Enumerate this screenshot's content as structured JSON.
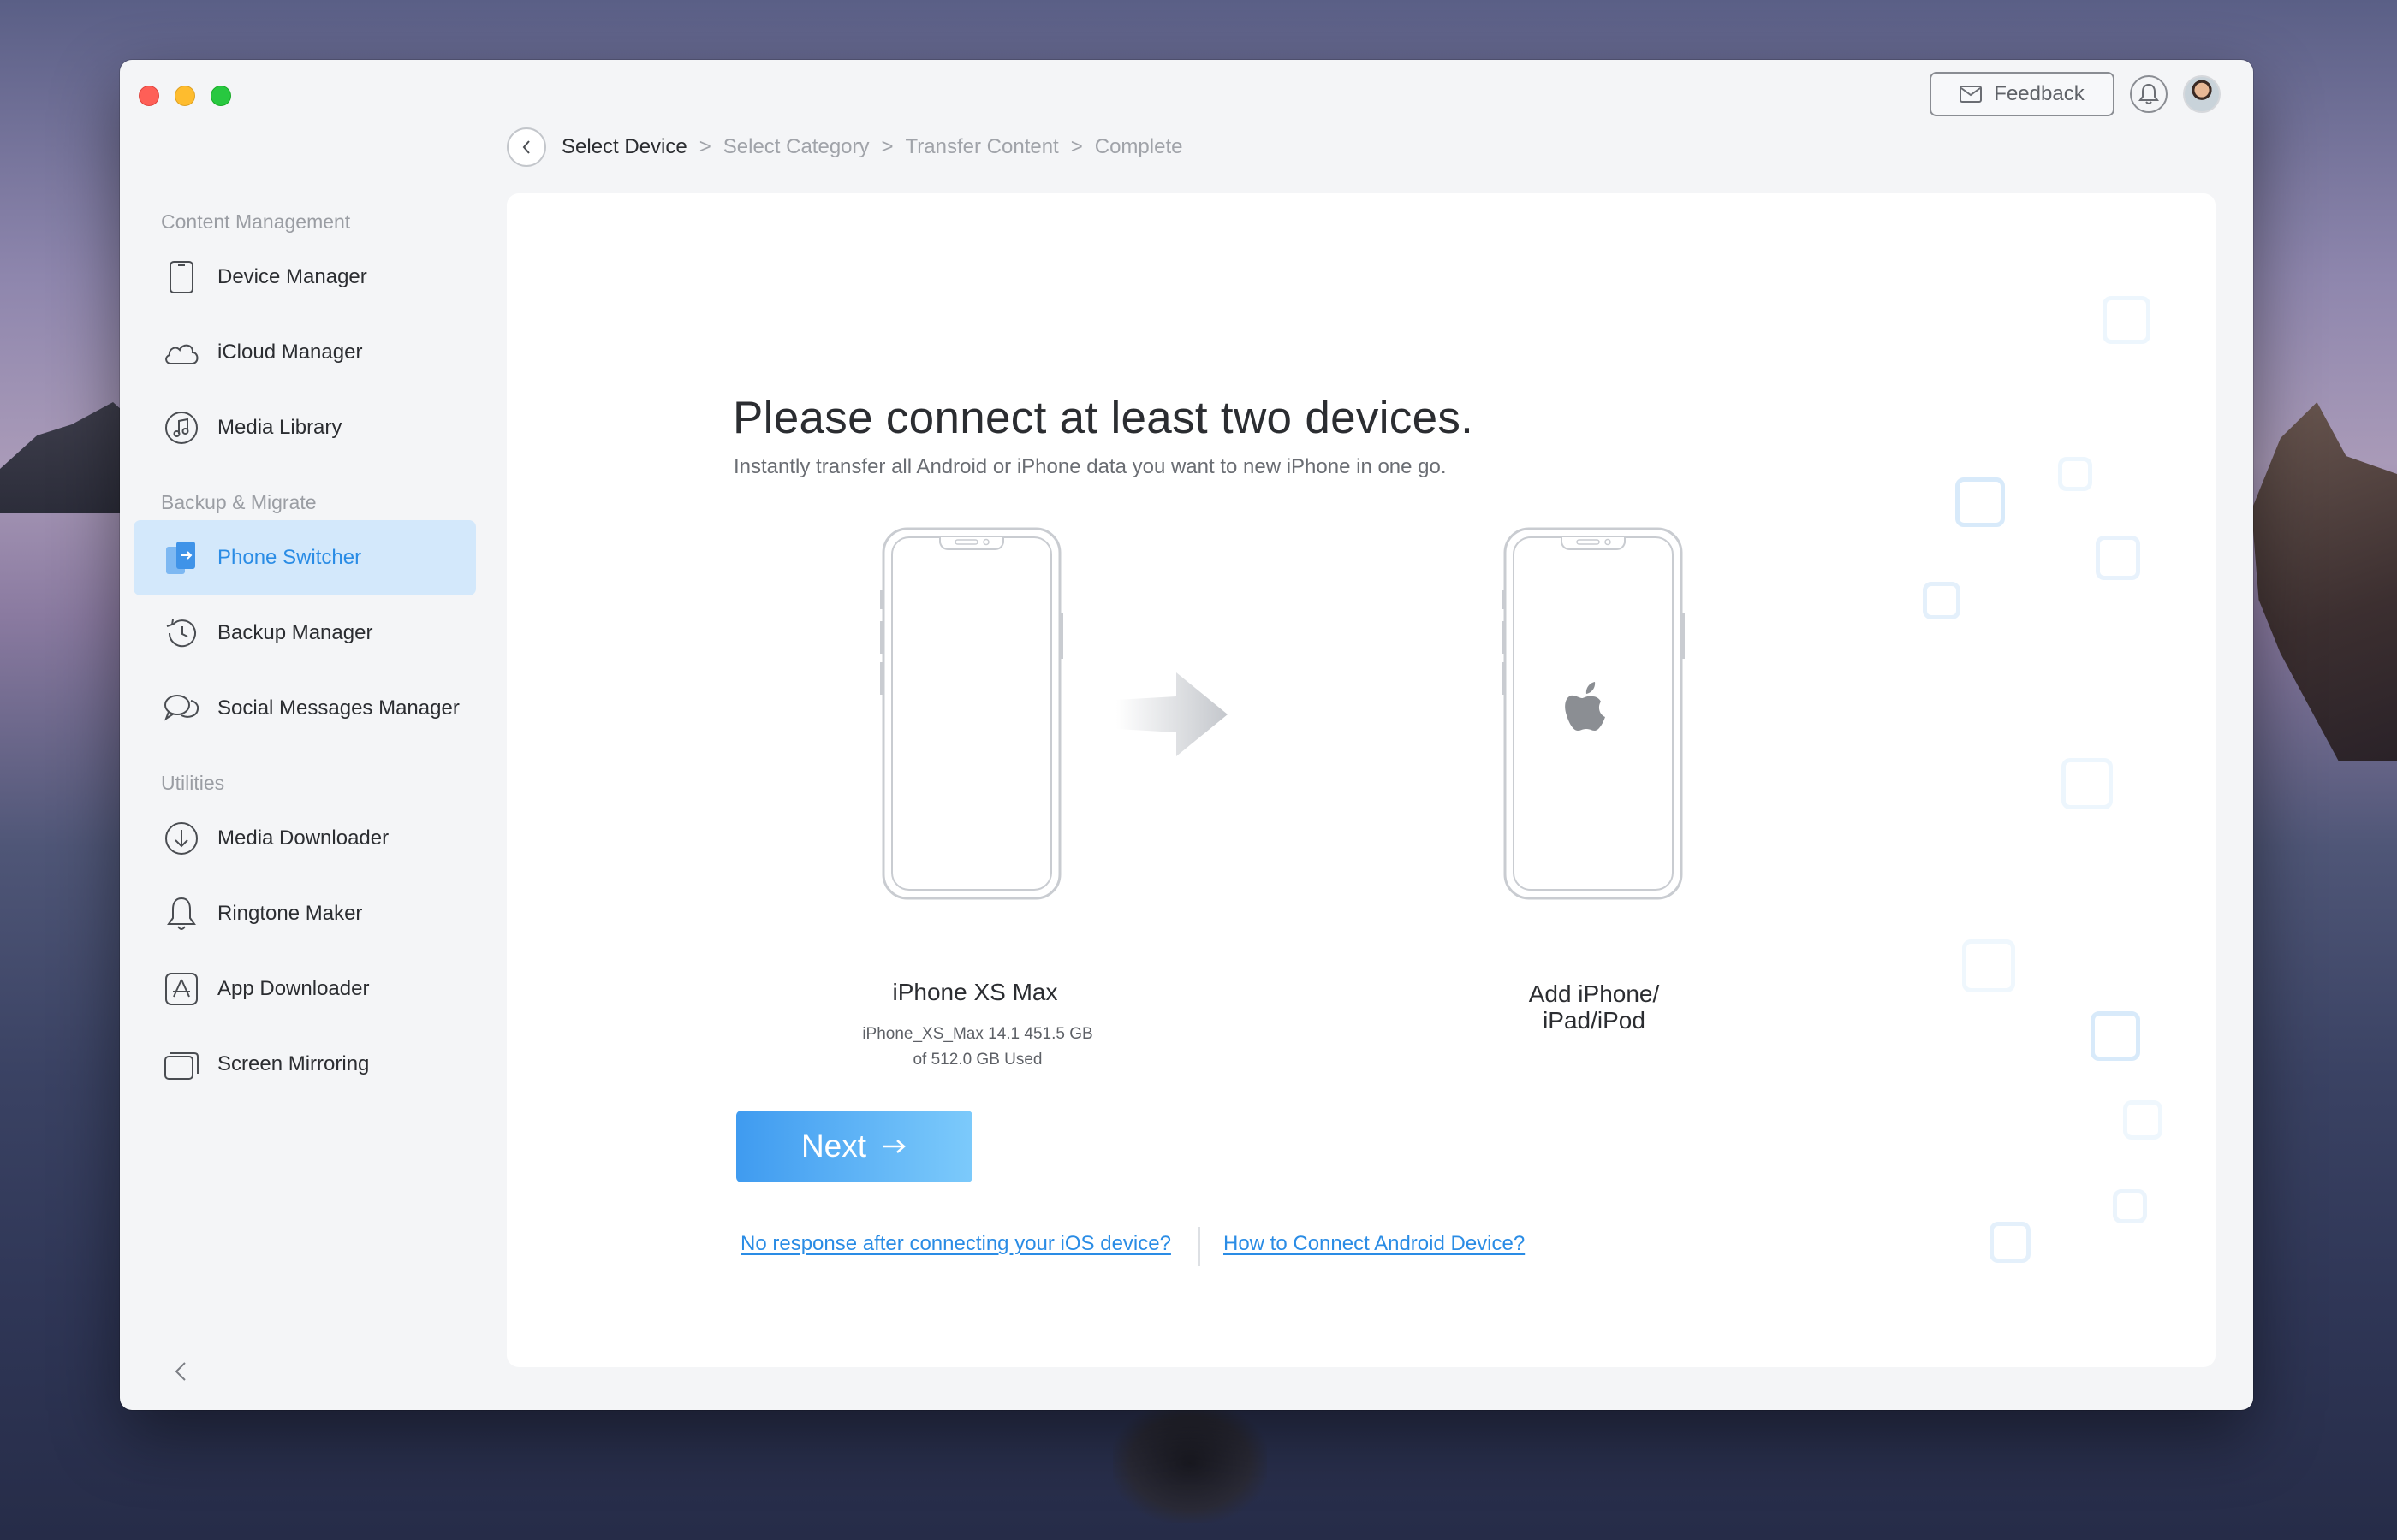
{
  "window": {
    "feedback_label": "Feedback"
  },
  "sidebar": {
    "sections": [
      {
        "title": "Content Management"
      },
      {
        "title": "Backup & Migrate"
      },
      {
        "title": "Utilities"
      }
    ],
    "items": [
      {
        "label": "Device Manager",
        "icon": "phone-icon"
      },
      {
        "label": "iCloud Manager",
        "icon": "cloud-icon"
      },
      {
        "label": "Media Library",
        "icon": "music-icon"
      },
      {
        "label": "Phone Switcher",
        "icon": "phone-switch-icon",
        "active": true
      },
      {
        "label": "Backup Manager",
        "icon": "history-icon"
      },
      {
        "label": "Social Messages Manager",
        "icon": "chat-icon"
      },
      {
        "label": "Media Downloader",
        "icon": "download-icon"
      },
      {
        "label": "Ringtone Maker",
        "icon": "bell-icon"
      },
      {
        "label": "App Downloader",
        "icon": "app-store-icon"
      },
      {
        "label": "Screen Mirroring",
        "icon": "screens-icon"
      }
    ]
  },
  "breadcrumb": {
    "steps": [
      "Select Device",
      "Select Category",
      "Transfer Content",
      "Complete"
    ],
    "separator": ">"
  },
  "main": {
    "headline": "Please connect at least two devices.",
    "subline": "Instantly transfer all Android or iPhone data you want to new iPhone in one go.",
    "source_device": {
      "name": "iPhone XS Max",
      "info_line1": "iPhone_XS_Max 14.1 451.5 GB",
      "info_line2": "of  512.0 GB Used"
    },
    "target_device": {
      "name_line1": "Add iPhone/",
      "name_line2": "iPad/iPod"
    },
    "next_label": "Next",
    "links": {
      "ios_help": "No response after connecting your iOS device?",
      "android_help": "How to Connect Android Device?"
    }
  },
  "colors": {
    "accent": "#2a8ce5",
    "active_bg": "#d3e8fb"
  }
}
